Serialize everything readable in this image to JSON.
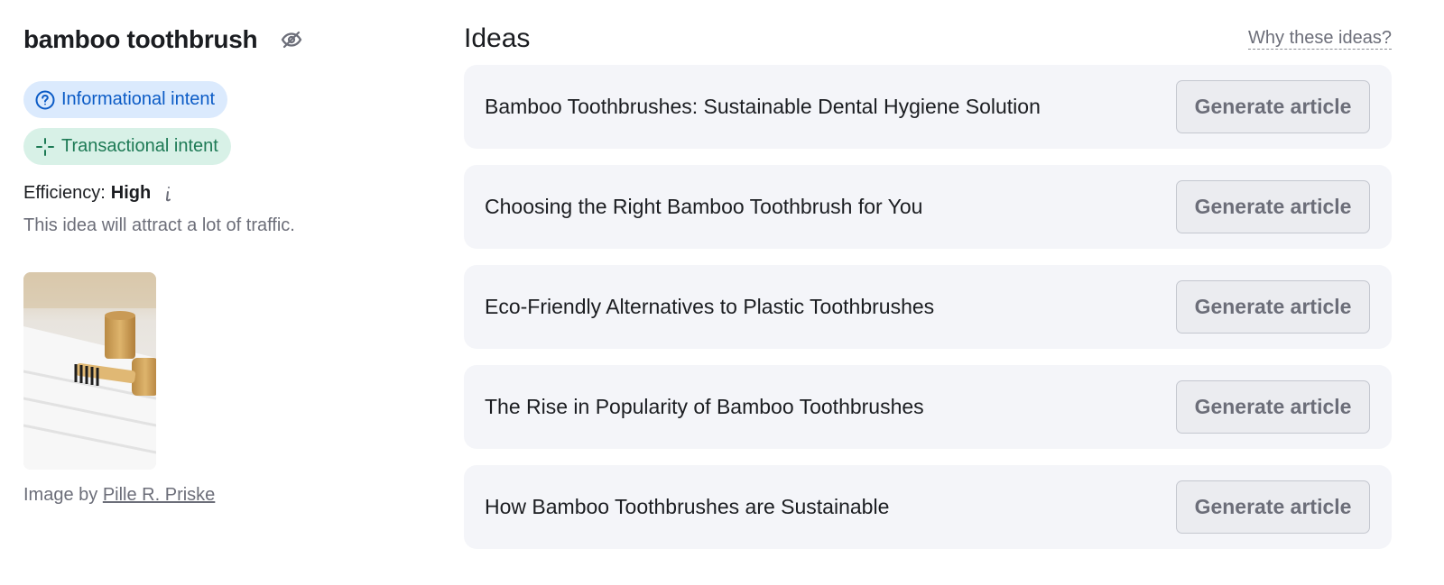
{
  "keyword": {
    "title": "bamboo toothbrush",
    "hide_icon": "eye-off-icon"
  },
  "intents": [
    {
      "label": "Informational intent",
      "icon": "question-circle-icon",
      "color": "#0b5bc6",
      "bg": "#dbeafd"
    },
    {
      "label": "Transactional intent",
      "icon": "crosshair-icon",
      "color": "#1d7a55",
      "bg": "#d8f1e7"
    }
  ],
  "efficiency": {
    "label": "Efficiency:",
    "value": "High",
    "info_icon": "info-icon",
    "description": "This idea will attract a lot of traffic."
  },
  "image": {
    "credit_prefix": "Image by",
    "author": "Pille R. Priske"
  },
  "ideas": {
    "title": "Ideas",
    "why_link": "Why these ideas?",
    "button_label": "Generate article",
    "items": [
      {
        "text": "Bamboo Toothbrushes: Sustainable Dental Hygiene Solution"
      },
      {
        "text": "Choosing the Right Bamboo Toothbrush for You"
      },
      {
        "text": "Eco-Friendly Alternatives to Plastic Toothbrushes"
      },
      {
        "text": "The Rise in Popularity of Bamboo Toothbrushes"
      },
      {
        "text": "How Bamboo Toothbrushes are Sustainable"
      }
    ]
  }
}
